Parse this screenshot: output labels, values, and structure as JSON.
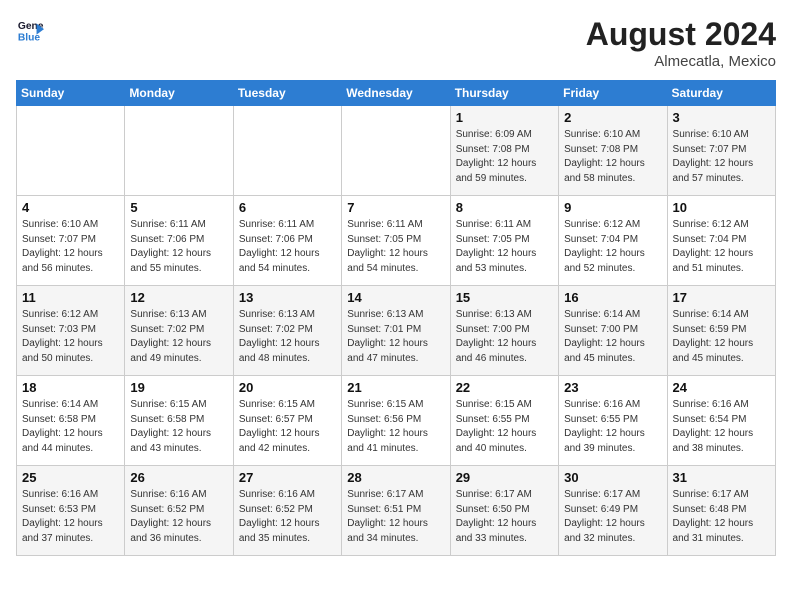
{
  "header": {
    "logo_line1": "General",
    "logo_line2": "Blue",
    "month_year": "August 2024",
    "location": "Almecatla, Mexico"
  },
  "weekdays": [
    "Sunday",
    "Monday",
    "Tuesday",
    "Wednesday",
    "Thursday",
    "Friday",
    "Saturday"
  ],
  "weeks": [
    [
      {
        "day": "",
        "sunrise": "",
        "sunset": "",
        "daylight": ""
      },
      {
        "day": "",
        "sunrise": "",
        "sunset": "",
        "daylight": ""
      },
      {
        "day": "",
        "sunrise": "",
        "sunset": "",
        "daylight": ""
      },
      {
        "day": "",
        "sunrise": "",
        "sunset": "",
        "daylight": ""
      },
      {
        "day": "1",
        "sunrise": "Sunrise: 6:09 AM",
        "sunset": "Sunset: 7:08 PM",
        "daylight": "Daylight: 12 hours and 59 minutes."
      },
      {
        "day": "2",
        "sunrise": "Sunrise: 6:10 AM",
        "sunset": "Sunset: 7:08 PM",
        "daylight": "Daylight: 12 hours and 58 minutes."
      },
      {
        "day": "3",
        "sunrise": "Sunrise: 6:10 AM",
        "sunset": "Sunset: 7:07 PM",
        "daylight": "Daylight: 12 hours and 57 minutes."
      }
    ],
    [
      {
        "day": "4",
        "sunrise": "Sunrise: 6:10 AM",
        "sunset": "Sunset: 7:07 PM",
        "daylight": "Daylight: 12 hours and 56 minutes."
      },
      {
        "day": "5",
        "sunrise": "Sunrise: 6:11 AM",
        "sunset": "Sunset: 7:06 PM",
        "daylight": "Daylight: 12 hours and 55 minutes."
      },
      {
        "day": "6",
        "sunrise": "Sunrise: 6:11 AM",
        "sunset": "Sunset: 7:06 PM",
        "daylight": "Daylight: 12 hours and 54 minutes."
      },
      {
        "day": "7",
        "sunrise": "Sunrise: 6:11 AM",
        "sunset": "Sunset: 7:05 PM",
        "daylight": "Daylight: 12 hours and 54 minutes."
      },
      {
        "day": "8",
        "sunrise": "Sunrise: 6:11 AM",
        "sunset": "Sunset: 7:05 PM",
        "daylight": "Daylight: 12 hours and 53 minutes."
      },
      {
        "day": "9",
        "sunrise": "Sunrise: 6:12 AM",
        "sunset": "Sunset: 7:04 PM",
        "daylight": "Daylight: 12 hours and 52 minutes."
      },
      {
        "day": "10",
        "sunrise": "Sunrise: 6:12 AM",
        "sunset": "Sunset: 7:04 PM",
        "daylight": "Daylight: 12 hours and 51 minutes."
      }
    ],
    [
      {
        "day": "11",
        "sunrise": "Sunrise: 6:12 AM",
        "sunset": "Sunset: 7:03 PM",
        "daylight": "Daylight: 12 hours and 50 minutes."
      },
      {
        "day": "12",
        "sunrise": "Sunrise: 6:13 AM",
        "sunset": "Sunset: 7:02 PM",
        "daylight": "Daylight: 12 hours and 49 minutes."
      },
      {
        "day": "13",
        "sunrise": "Sunrise: 6:13 AM",
        "sunset": "Sunset: 7:02 PM",
        "daylight": "Daylight: 12 hours and 48 minutes."
      },
      {
        "day": "14",
        "sunrise": "Sunrise: 6:13 AM",
        "sunset": "Sunset: 7:01 PM",
        "daylight": "Daylight: 12 hours and 47 minutes."
      },
      {
        "day": "15",
        "sunrise": "Sunrise: 6:13 AM",
        "sunset": "Sunset: 7:00 PM",
        "daylight": "Daylight: 12 hours and 46 minutes."
      },
      {
        "day": "16",
        "sunrise": "Sunrise: 6:14 AM",
        "sunset": "Sunset: 7:00 PM",
        "daylight": "Daylight: 12 hours and 45 minutes."
      },
      {
        "day": "17",
        "sunrise": "Sunrise: 6:14 AM",
        "sunset": "Sunset: 6:59 PM",
        "daylight": "Daylight: 12 hours and 45 minutes."
      }
    ],
    [
      {
        "day": "18",
        "sunrise": "Sunrise: 6:14 AM",
        "sunset": "Sunset: 6:58 PM",
        "daylight": "Daylight: 12 hours and 44 minutes."
      },
      {
        "day": "19",
        "sunrise": "Sunrise: 6:15 AM",
        "sunset": "Sunset: 6:58 PM",
        "daylight": "Daylight: 12 hours and 43 minutes."
      },
      {
        "day": "20",
        "sunrise": "Sunrise: 6:15 AM",
        "sunset": "Sunset: 6:57 PM",
        "daylight": "Daylight: 12 hours and 42 minutes."
      },
      {
        "day": "21",
        "sunrise": "Sunrise: 6:15 AM",
        "sunset": "Sunset: 6:56 PM",
        "daylight": "Daylight: 12 hours and 41 minutes."
      },
      {
        "day": "22",
        "sunrise": "Sunrise: 6:15 AM",
        "sunset": "Sunset: 6:55 PM",
        "daylight": "Daylight: 12 hours and 40 minutes."
      },
      {
        "day": "23",
        "sunrise": "Sunrise: 6:16 AM",
        "sunset": "Sunset: 6:55 PM",
        "daylight": "Daylight: 12 hours and 39 minutes."
      },
      {
        "day": "24",
        "sunrise": "Sunrise: 6:16 AM",
        "sunset": "Sunset: 6:54 PM",
        "daylight": "Daylight: 12 hours and 38 minutes."
      }
    ],
    [
      {
        "day": "25",
        "sunrise": "Sunrise: 6:16 AM",
        "sunset": "Sunset: 6:53 PM",
        "daylight": "Daylight: 12 hours and 37 minutes."
      },
      {
        "day": "26",
        "sunrise": "Sunrise: 6:16 AM",
        "sunset": "Sunset: 6:52 PM",
        "daylight": "Daylight: 12 hours and 36 minutes."
      },
      {
        "day": "27",
        "sunrise": "Sunrise: 6:16 AM",
        "sunset": "Sunset: 6:52 PM",
        "daylight": "Daylight: 12 hours and 35 minutes."
      },
      {
        "day": "28",
        "sunrise": "Sunrise: 6:17 AM",
        "sunset": "Sunset: 6:51 PM",
        "daylight": "Daylight: 12 hours and 34 minutes."
      },
      {
        "day": "29",
        "sunrise": "Sunrise: 6:17 AM",
        "sunset": "Sunset: 6:50 PM",
        "daylight": "Daylight: 12 hours and 33 minutes."
      },
      {
        "day": "30",
        "sunrise": "Sunrise: 6:17 AM",
        "sunset": "Sunset: 6:49 PM",
        "daylight": "Daylight: 12 hours and 32 minutes."
      },
      {
        "day": "31",
        "sunrise": "Sunrise: 6:17 AM",
        "sunset": "Sunset: 6:48 PM",
        "daylight": "Daylight: 12 hours and 31 minutes."
      }
    ]
  ]
}
